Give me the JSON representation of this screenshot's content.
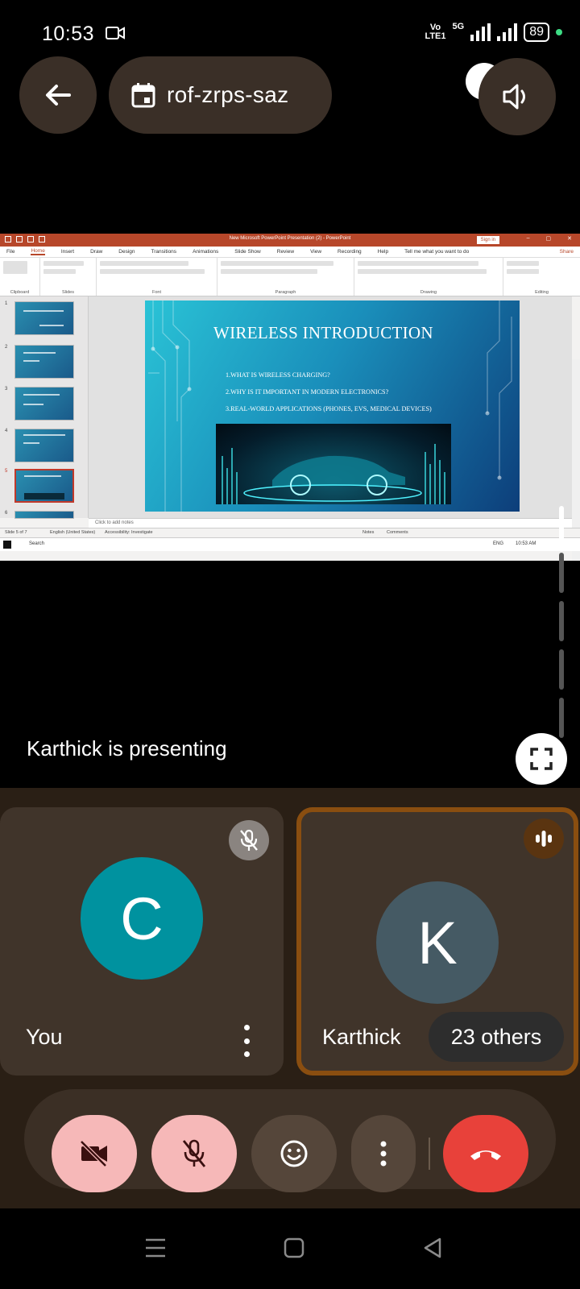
{
  "status_bar": {
    "time": "10:53",
    "volte_top": "Vo",
    "volte_bottom": "LTE1",
    "network": "5G",
    "battery": "89"
  },
  "meeting": {
    "code": "rof-zrps-saz"
  },
  "presentation": {
    "app_title": "New Microsoft PowerPoint Presentation (2)  -  PowerPoint",
    "sign_in": "Sign in",
    "menu": [
      "File",
      "Home",
      "Insert",
      "Draw",
      "Design",
      "Transitions",
      "Animations",
      "Slide Show",
      "Review",
      "View",
      "Recording",
      "Help"
    ],
    "tell_me": "Tell me what you want to do",
    "share": "Share",
    "ribbon_groups": [
      "Clipboard",
      "Slides",
      "Font",
      "Paragraph",
      "Drawing",
      "Editing"
    ],
    "slide_title": "WIRELESS INTRODUCTION",
    "slide_points": [
      "1.WHAT IS WIRELESS CHARGING?",
      "2.WHY IS IT IMPORTANT IN MODERN ELECTRONICS?",
      "3.REAL-WORLD APPLICATIONS (PHONES, EVS, MEDICAL DEVICES)"
    ],
    "thumb_numbers": [
      "1",
      "2",
      "3",
      "4",
      "5",
      "6"
    ],
    "notes_placeholder": "Click to add notes",
    "status_slide": "Slide 5 of 7",
    "status_lang": "English (United States)",
    "status_access": "Accessibility: Investigate",
    "status_notes": "Notes",
    "status_comments": "Comments",
    "taskbar_search": "Search",
    "taskbar_lang": "ENG",
    "taskbar_time": "10:53 AM"
  },
  "presenting_label": "Karthick is presenting",
  "tiles": [
    {
      "initial": "C",
      "name": "You"
    },
    {
      "initial": "K",
      "name": "Karthick",
      "others": "23 others"
    }
  ],
  "colors": {
    "end_call": "#e8413a",
    "muted_control": "#f6b8b8",
    "avatar_you": "#00929f",
    "avatar_karthick": "#455a64",
    "active_speaker_border": "#8a4e10"
  }
}
